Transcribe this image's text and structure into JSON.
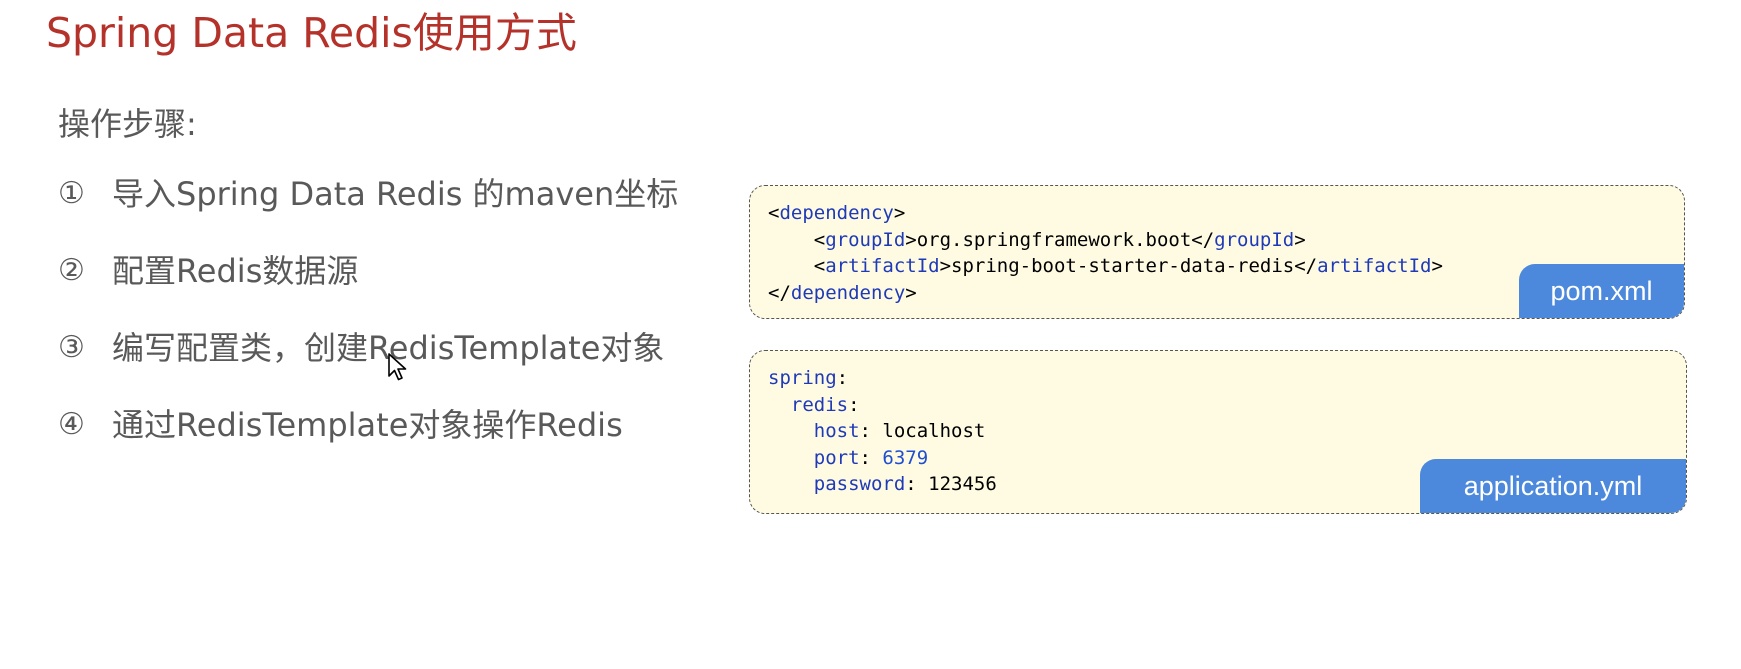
{
  "title": "Spring Data Redis使用方式",
  "subtitle": "操作步骤:",
  "steps": [
    {
      "num": "①",
      "text": "导入Spring Data Redis 的maven坐标"
    },
    {
      "num": "②",
      "text": "配置Redis数据源"
    },
    {
      "num": "③",
      "text": "编写配置类，创建RedisTemplate对象"
    },
    {
      "num": "④",
      "text": "通过RedisTemplate对象操作Redis"
    }
  ],
  "pom": {
    "label": "pom.xml",
    "dependency_tag": "dependency",
    "groupId_tag": "groupId",
    "groupId_value": "org.springframework.boot",
    "artifactId_tag": "artifactId",
    "artifactId_value": "spring-boot-starter-data-redis"
  },
  "yml": {
    "label": "application.yml",
    "spring_key": "spring",
    "redis_key": "redis",
    "host_key": "host",
    "host_value": "localhost",
    "port_key": "port",
    "port_value": "6379",
    "password_key": "password",
    "password_value": "123456"
  },
  "colors": {
    "title": "#b5322b",
    "text": "#595959",
    "code_bg": "#fefbe2",
    "keyword": "#1f3ab8",
    "label_bg": "#4c89dc"
  },
  "icons": {
    "cursor": "mouse-pointer-icon"
  }
}
